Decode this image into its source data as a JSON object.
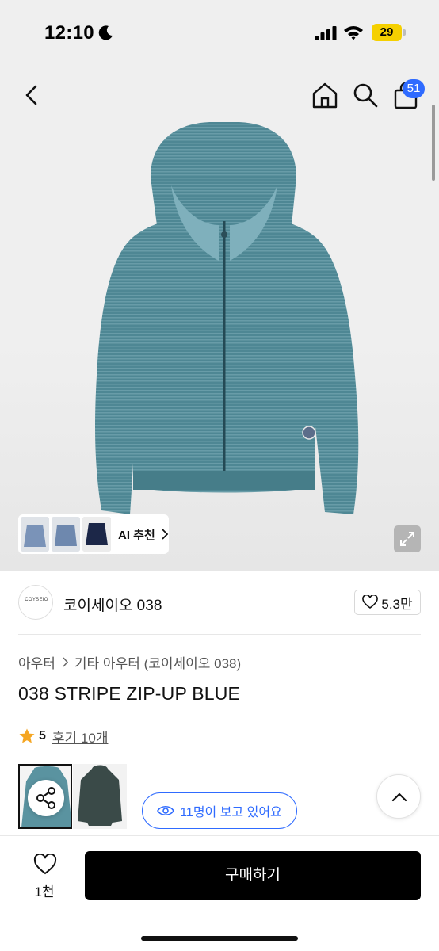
{
  "status_bar": {
    "time": "12:10",
    "battery": "29"
  },
  "header": {
    "cart_count": "51"
  },
  "gallery": {
    "ai_label": "AI 추천"
  },
  "brand": {
    "logo_text": "COYSEIO",
    "name": "코이세이오 038",
    "likes": "5.3만"
  },
  "breadcrumb": {
    "category": "아우터",
    "subcategory": "기타 아우터 (코이세이오 038)"
  },
  "product": {
    "title": "038 STRIPE ZIP-UP BLUE",
    "rating": "5",
    "reviews": "후기 10개"
  },
  "viewers": {
    "text": "11명이 보고 있어요"
  },
  "bottom_bar": {
    "wishlist_count": "1천",
    "buy_label": "구매하기"
  },
  "colors": {
    "accent": "#2f6bff",
    "hoodie_main": "#4e8794",
    "buy_button": "#000000",
    "star": "#f5a623"
  }
}
